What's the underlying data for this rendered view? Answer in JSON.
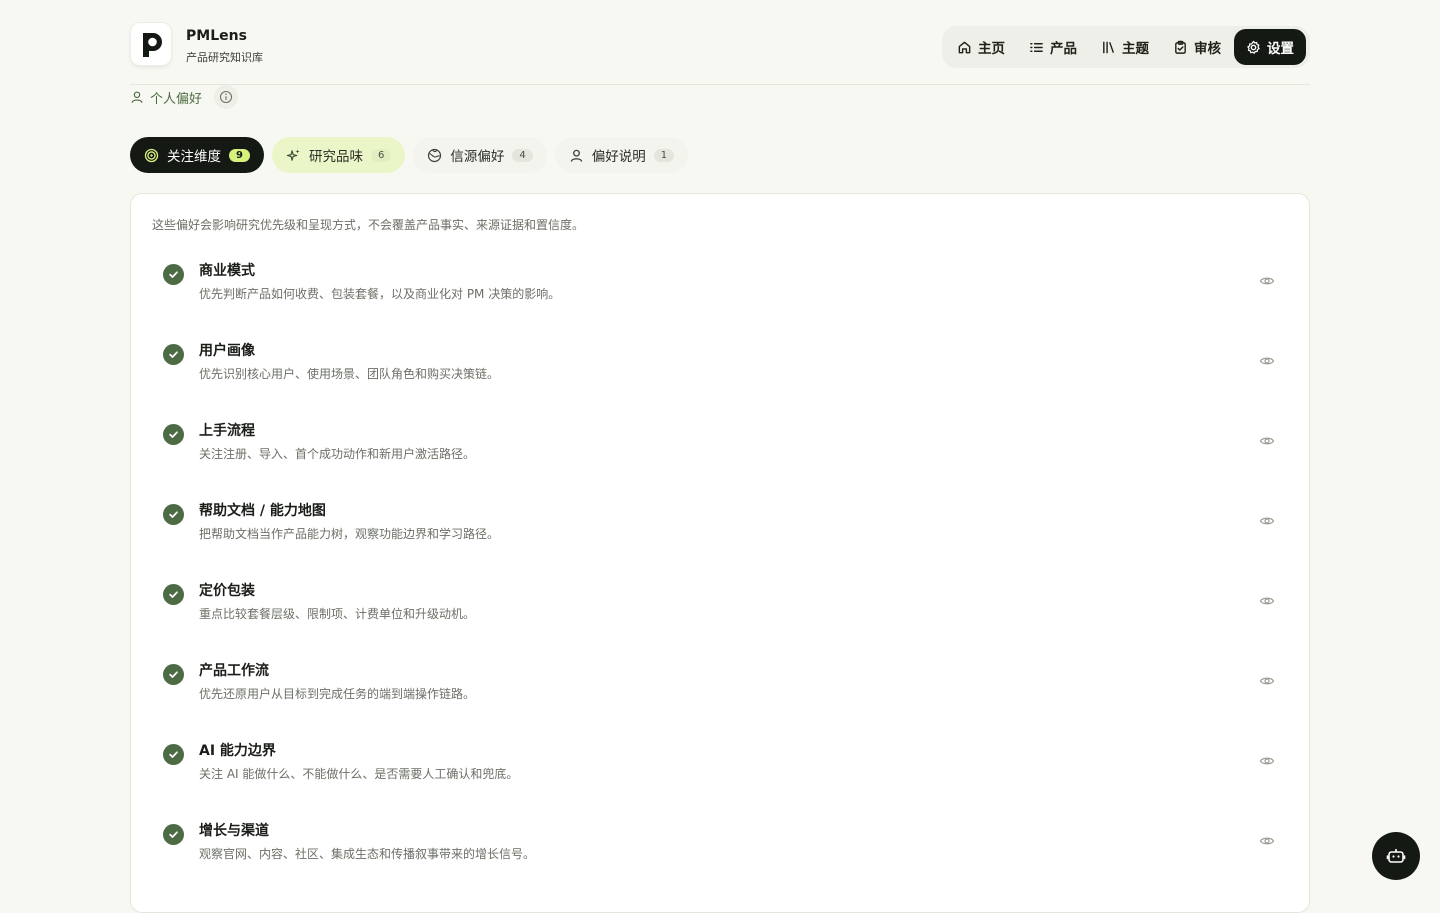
{
  "brand": {
    "name": "PMLens",
    "subtitle": "产品研究知识库"
  },
  "nav": [
    {
      "label": "主页",
      "icon": "home-icon"
    },
    {
      "label": "产品",
      "icon": "list-icon"
    },
    {
      "label": "主题",
      "icon": "library-icon"
    },
    {
      "label": "审核",
      "icon": "clipboard-check-icon"
    },
    {
      "label": "设置",
      "icon": "gear-icon",
      "active": true
    }
  ],
  "section": {
    "label": "个人偏好",
    "icon": "user-icon",
    "info_icon": "info-icon"
  },
  "tabs": [
    {
      "label": "关注维度",
      "count": "9",
      "icon": "target-icon",
      "active": true
    },
    {
      "label": "研究品味",
      "count": "6",
      "icon": "sparkles-icon"
    },
    {
      "label": "信源偏好",
      "count": "4",
      "icon": "globe-icon"
    },
    {
      "label": "偏好说明",
      "count": "1",
      "icon": "user-icon"
    }
  ],
  "panel": {
    "note": "这些偏好会影响研究优先级和呈现方式，不会覆盖产品事实、来源证据和置信度。",
    "items": [
      {
        "title": "商业模式",
        "desc": "优先判断产品如何收费、包装套餐，以及商业化对 PM 决策的影响。"
      },
      {
        "title": "用户画像",
        "desc": "优先识别核心用户、使用场景、团队角色和购买决策链。"
      },
      {
        "title": "上手流程",
        "desc": "关注注册、导入、首个成功动作和新用户激活路径。"
      },
      {
        "title": "帮助文档 / 能力地图",
        "desc": "把帮助文档当作产品能力树，观察功能边界和学习路径。"
      },
      {
        "title": "定价包装",
        "desc": "重点比较套餐层级、限制项、计费单位和升级动机。"
      },
      {
        "title": "产品工作流",
        "desc": "优先还原用户从目标到完成任务的端到端操作链路。"
      },
      {
        "title": "AI 能力边界",
        "desc": "关注 AI 能做什么、不能做什么、是否需要人工确认和兜底。"
      },
      {
        "title": "增长与渠道",
        "desc": "观察官网、内容、社区、集成生态和传播叙事带来的增长信号。"
      }
    ]
  },
  "colors": {
    "accent": "#4c6b44",
    "dark": "#151914",
    "lime": "#d6f27e",
    "background": "#f8f8f3"
  }
}
